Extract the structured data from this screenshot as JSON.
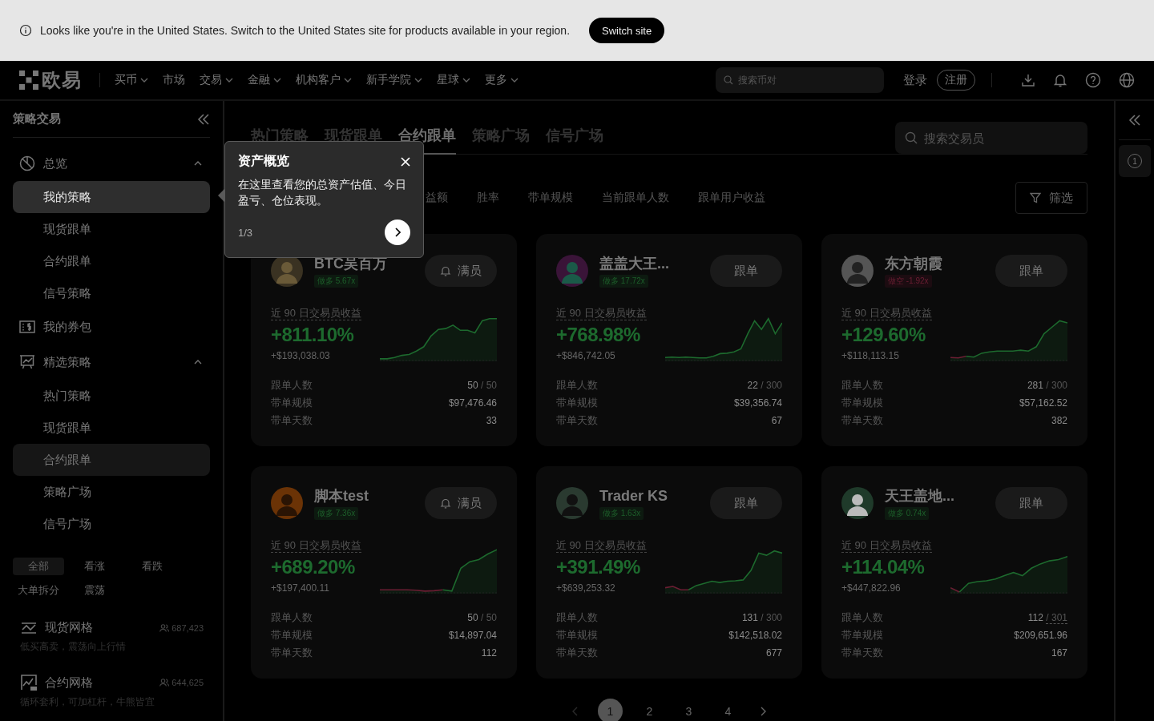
{
  "notice": {
    "text": "Looks like you're in the United States. Switch to the United States site for products available in your region.",
    "button": "Switch site"
  },
  "header": {
    "logo": "欧易",
    "nav": [
      {
        "label": "买币",
        "dropdown": true
      },
      {
        "label": "市场",
        "dropdown": false
      },
      {
        "label": "交易",
        "dropdown": true
      },
      {
        "label": "金融",
        "dropdown": true
      },
      {
        "label": "机构客户",
        "dropdown": true
      },
      {
        "label": "新手学院",
        "dropdown": true
      },
      {
        "label": "星球",
        "dropdown": true
      },
      {
        "label": "更多",
        "dropdown": true
      }
    ],
    "search": {
      "placeholder": "搜索币对"
    },
    "login": "登录",
    "register": "注册"
  },
  "sidebar": {
    "title": "策略交易",
    "groups": [
      {
        "label": "总览",
        "kind": "group",
        "expanded": true,
        "children": [
          {
            "label": "我的策略",
            "selected": false,
            "spotlight": true
          },
          {
            "label": "现货跟单",
            "selected": false,
            "spotlight": false
          },
          {
            "label": "合约跟单",
            "selected": false,
            "spotlight": false
          },
          {
            "label": "信号策略",
            "selected": false,
            "spotlight": false
          }
        ]
      },
      {
        "label": "我的券包",
        "kind": "link"
      },
      {
        "label": "精选策略",
        "kind": "group",
        "expanded": true,
        "children": [
          {
            "label": "热门策略",
            "selected": false,
            "spotlight": false
          },
          {
            "label": "现货跟单",
            "selected": false,
            "spotlight": false
          },
          {
            "label": "合约跟单",
            "selected": true,
            "spotlight": false
          },
          {
            "label": "策略广场",
            "selected": false,
            "spotlight": false
          },
          {
            "label": "信号广场",
            "selected": false,
            "spotlight": false
          }
        ]
      }
    ],
    "chips": [
      {
        "label": "全部",
        "selected": true
      },
      {
        "label": "看涨",
        "selected": false
      },
      {
        "label": "看跌",
        "selected": false
      },
      {
        "label": "大单拆分",
        "selected": false
      },
      {
        "label": "震荡",
        "selected": false
      }
    ],
    "strategies": [
      {
        "name": "现货网格",
        "users": "687,423",
        "description": "低买高卖，震荡向上行情"
      },
      {
        "name": "合约网格",
        "users": "644,625",
        "description": "循环套利，可加杠杆，牛熊皆宜"
      }
    ]
  },
  "main": {
    "tabs": [
      {
        "label": "热门策略",
        "selected": false
      },
      {
        "label": "现货跟单",
        "selected": false
      },
      {
        "label": "合约跟单",
        "selected": true
      },
      {
        "label": "策略广场",
        "selected": false
      },
      {
        "label": "信号广场",
        "selected": false
      }
    ],
    "search": {
      "placeholder": "搜索交易员"
    },
    "sort": [
      "益额",
      "胜率",
      "带单规模",
      "当前跟单人数",
      "跟单用户收益"
    ],
    "filter": "筛选",
    "traders": [
      {
        "name": "BTC吴百万",
        "kind": "long",
        "tag": "做多 5.67x",
        "action": {
          "kind": "full",
          "label": "满员"
        },
        "return_label": "近 90 日交易员收益",
        "return": "+811.10%",
        "pnl": "+$193,038.03",
        "stats": [
          {
            "label": "跟单人数",
            "value": "50",
            "total": "/ 50",
            "underlined": false
          },
          {
            "label": "带单规模",
            "value": "$97,476.46"
          },
          {
            "label": "带单天数",
            "value": "33"
          }
        ]
      },
      {
        "name": "盖盖大王...",
        "kind": "long",
        "tag": "做多 17.72x",
        "action": {
          "kind": "follow",
          "label": "跟单"
        },
        "return_label": "近 90 日交易员收益",
        "return": "+768.98%",
        "pnl": "+$846,742.05",
        "stats": [
          {
            "label": "跟单人数",
            "value": "22",
            "total": "/ 300",
            "underlined": false
          },
          {
            "label": "带单规模",
            "value": "$39,356.74"
          },
          {
            "label": "带单天数",
            "value": "67"
          }
        ]
      },
      {
        "name": "东方朝霞",
        "kind": "short",
        "tag": "做空 -1.92x",
        "action": {
          "kind": "follow",
          "label": "跟单"
        },
        "return_label": "近 90 日交易员收益",
        "return": "+129.60%",
        "pnl": "+$118,113.15",
        "stats": [
          {
            "label": "跟单人数",
            "value": "281",
            "total": "/ 300",
            "underlined": false
          },
          {
            "label": "带单规模",
            "value": "$57,162.52"
          },
          {
            "label": "带单天数",
            "value": "382"
          }
        ]
      },
      {
        "name": "脚本test",
        "kind": "long",
        "tag": "做多 7.36x",
        "action": {
          "kind": "full",
          "label": "满员"
        },
        "return_label": "近 90 日交易员收益",
        "return": "+689.20%",
        "pnl": "+$197,400.11",
        "stats": [
          {
            "label": "跟单人数",
            "value": "50",
            "total": "/ 50",
            "underlined": false
          },
          {
            "label": "带单规模",
            "value": "$14,897.04"
          },
          {
            "label": "带单天数",
            "value": "112"
          }
        ]
      },
      {
        "name": "Trader KS",
        "kind": "long",
        "tag": "做多 1.63x",
        "action": {
          "kind": "follow",
          "label": "跟单"
        },
        "return_label": "近 90 日交易员收益",
        "return": "+391.49%",
        "pnl": "+$639,253.32",
        "stats": [
          {
            "label": "跟单人数",
            "value": "131",
            "total": "/ 300",
            "underlined": false
          },
          {
            "label": "带单规模",
            "value": "$142,518.02"
          },
          {
            "label": "带单天数",
            "value": "677"
          }
        ]
      },
      {
        "name": "天王盖地...",
        "kind": "long",
        "tag": "做多 0.74x",
        "action": {
          "kind": "follow",
          "label": "跟单"
        },
        "return_label": "近 90 日交易员收益",
        "return": "+114.04%",
        "pnl": "+$447,822.96",
        "stats": [
          {
            "label": "跟单人数",
            "value": "112",
            "total": "/ 301",
            "underlined": true
          },
          {
            "label": "带单规模",
            "value": "$209,651.96"
          },
          {
            "label": "带单天数",
            "value": "167"
          }
        ]
      }
    ],
    "pages": [
      {
        "label": "1",
        "selected": true
      },
      {
        "label": "2",
        "selected": false
      },
      {
        "label": "3",
        "selected": false
      },
      {
        "label": "4",
        "selected": false
      }
    ]
  },
  "tour": {
    "title": "资产概览",
    "body": "在这里查看您的总资产估值、今日盈亏、仓位表现。",
    "step": "1/3"
  },
  "rail": {
    "step": "1"
  }
}
